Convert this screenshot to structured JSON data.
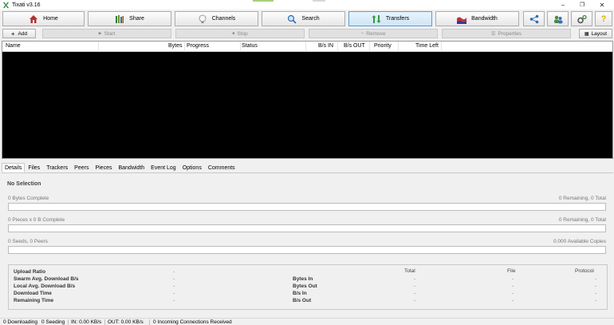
{
  "window": {
    "title": "Tixati v3.16",
    "minimize_glyph": "–",
    "maximize_glyph": "❐",
    "close_glyph": "✕"
  },
  "toolbar": {
    "home_label": "Home",
    "share_label": "Share",
    "channels_label": "Channels",
    "search_label": "Search",
    "transfers_label": "Transfers",
    "bandwidth_label": "Bandwidth",
    "help_glyph": "?"
  },
  "actions": {
    "add_label": "Add",
    "start_label": "Start",
    "stop_label": "Stop",
    "remove_label": "Remove",
    "properties_label": "Properties",
    "layout_label": "Layout"
  },
  "transfers_table": {
    "columns": [
      "Name",
      "Bytes",
      "Progress",
      "Status",
      "B/s IN",
      "B/s OUT",
      "Priority",
      "Time Left"
    ]
  },
  "tabs": [
    "Details",
    "Files",
    "Trackers",
    "Peers",
    "Pieces",
    "Bandwidth",
    "Event Log",
    "Options",
    "Comments"
  ],
  "details": {
    "no_selection": "No Selection",
    "bytes_complete": "0 Bytes Complete",
    "bytes_remaining": "0 Remaining,  0 Total",
    "pieces_complete": "0 Pieces  x  0 B Complete",
    "pieces_remaining": "0 Remaining,  0 Total",
    "seeds_peers": "0 Seeds, 0 Peers",
    "available_copies": "0.000 Available Copies"
  },
  "stats": {
    "left_labels": [
      "Upload Ratio",
      "Swarm Avg. Download B/s",
      "Local Avg. Download B/s",
      "Download Time",
      "Remaining Time"
    ],
    "left_values": [
      "-",
      "-",
      "-",
      "-",
      "-"
    ],
    "mid_labels": [
      "Bytes In",
      "Bytes Out",
      "B/s In",
      "B/s Out"
    ],
    "col_headers": [
      "Total",
      "File",
      "Protocol"
    ],
    "dash": "-"
  },
  "statusbar": {
    "downloading": "0 Downloading",
    "seeding": "0 Seeding",
    "in": "IN: 0.00 KB/s",
    "out": "OUT: 0.00 KB/s",
    "connections": "0 Incoming Connections Received"
  },
  "colors": {
    "list_bg": "#000000",
    "active_tab_border": "#5a9bd5",
    "logo_green": "#2e8b3e"
  }
}
